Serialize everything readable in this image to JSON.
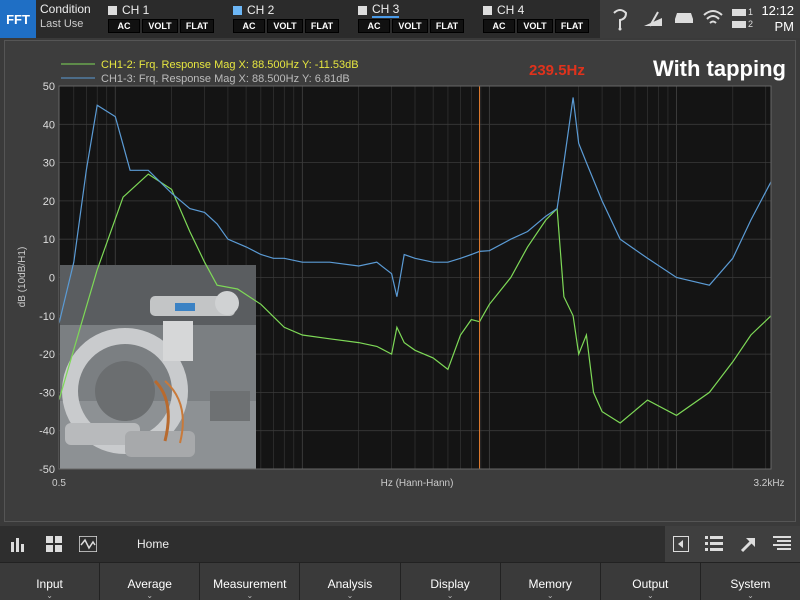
{
  "topbar": {
    "mode": "FFT",
    "condition_title": "Condition",
    "condition_sub": "Last Use",
    "channels": [
      {
        "label": "CH 1",
        "buttons": [
          "AC",
          "VOLT",
          "FLAT"
        ]
      },
      {
        "label": "CH 2",
        "buttons": [
          "AC",
          "VOLT",
          "FLAT"
        ]
      },
      {
        "label": "CH 3",
        "buttons": [
          "AC",
          "VOLT",
          "FLAT"
        ]
      },
      {
        "label": "CH 4",
        "buttons": [
          "AC",
          "VOLT",
          "FLAT"
        ]
      }
    ],
    "battery_labels": [
      "1",
      "2"
    ],
    "clock_time": "12:12",
    "clock_ampm": "PM",
    "icons": [
      "touch-icon",
      "gauge-icon",
      "drive-icon",
      "wifi-icon",
      "battery-icon"
    ]
  },
  "chart": {
    "legend": [
      {
        "text": "CH1-2: Frq. Response Mag   X: 88.500Hz Y: -11.53dB",
        "color": "#e6e640",
        "line_color": "#7ed957"
      },
      {
        "text": "CH1-3: Frq. Response Mag   X: 88.500Hz Y: 6.81dB",
        "color": "#bbbbbb",
        "line_color": "#5b9bd5"
      }
    ],
    "marker_readout": "239.5Hz",
    "annotation": "With tapping",
    "colors": {
      "plot_bg": "#141414",
      "grid": "#3a3a3a",
      "cursor": "#e07b2e",
      "marker_text": "#e0321c",
      "series1": "#7ed957",
      "series2": "#5b9bd5"
    }
  },
  "chart_data": {
    "type": "line",
    "xlabel": "Hz (Hann-Hann)",
    "ylabel": "dB (10dB/H1)",
    "x_scale": "log",
    "xlim": [
      0.5,
      3200
    ],
    "ylim": [
      -50,
      50
    ],
    "x_ticks": [
      "0.5",
      "3.2kHz"
    ],
    "y_ticks": [
      50,
      40,
      30,
      20,
      10,
      0,
      -10,
      -20,
      -30,
      -40,
      -50
    ],
    "cursor_x": 88.5,
    "grid": true,
    "series": [
      {
        "name": "CH1-2: Frq. Response Mag",
        "color": "#7ed957",
        "x": [
          0.5,
          0.65,
          0.8,
          1.1,
          1.5,
          2.0,
          2.5,
          3.0,
          3.5,
          4.5,
          6,
          8,
          10,
          14,
          20,
          25,
          30,
          32,
          35,
          40,
          50,
          60,
          70,
          80,
          88.5,
          100,
          130,
          160,
          200,
          230,
          250,
          280,
          300,
          330,
          360,
          400,
          500,
          700,
          1000,
          1500,
          2000,
          2500,
          3200
        ],
        "y": [
          -32,
          -13,
          2,
          21,
          27,
          23,
          12,
          4,
          -2,
          -3,
          -7,
          -13,
          -15,
          -16,
          -17,
          -18,
          -20,
          -13,
          -17,
          -19,
          -21,
          -24,
          -15,
          -11,
          -11.53,
          -7,
          0,
          8,
          15,
          18,
          -5,
          -10,
          -20,
          -15,
          -30,
          -35,
          -38,
          -32,
          -36,
          -30,
          -22,
          -15,
          -10
        ]
      },
      {
        "name": "CH1-3: Frq. Response Mag",
        "color": "#5b9bd5",
        "x": [
          0.5,
          0.6,
          0.7,
          0.8,
          1.0,
          1.2,
          1.5,
          2.0,
          2.5,
          3.0,
          3.5,
          4.0,
          5.0,
          6.0,
          7.0,
          8.0,
          10,
          14,
          20,
          25,
          30,
          32,
          35,
          40,
          50,
          60,
          70,
          80,
          88.5,
          100,
          130,
          160,
          200,
          230,
          250,
          280,
          300,
          330,
          400,
          500,
          700,
          1000,
          1500,
          2000,
          2500,
          3200
        ],
        "y": [
          -12,
          4,
          28,
          45,
          42,
          28,
          28,
          22,
          18,
          17,
          14,
          10,
          8,
          6,
          5,
          5,
          4,
          4,
          3,
          4,
          1,
          -5,
          6,
          5,
          4,
          4,
          5,
          6,
          6.81,
          7,
          10,
          12,
          16,
          18,
          30,
          47,
          35,
          30,
          20,
          10,
          5,
          0,
          -2,
          5,
          15,
          25
        ]
      }
    ]
  },
  "subbar": {
    "home_label": "Home",
    "left_icons": [
      "bar-chart-icon",
      "grid-icon",
      "waveform-icon"
    ],
    "right_icons": [
      "collapse-left-icon",
      "list-icon",
      "arrow-icon",
      "settings-list-icon"
    ]
  },
  "menu": [
    "Input",
    "Average",
    "Measurement",
    "Analysis",
    "Display",
    "Memory",
    "Output",
    "System"
  ]
}
